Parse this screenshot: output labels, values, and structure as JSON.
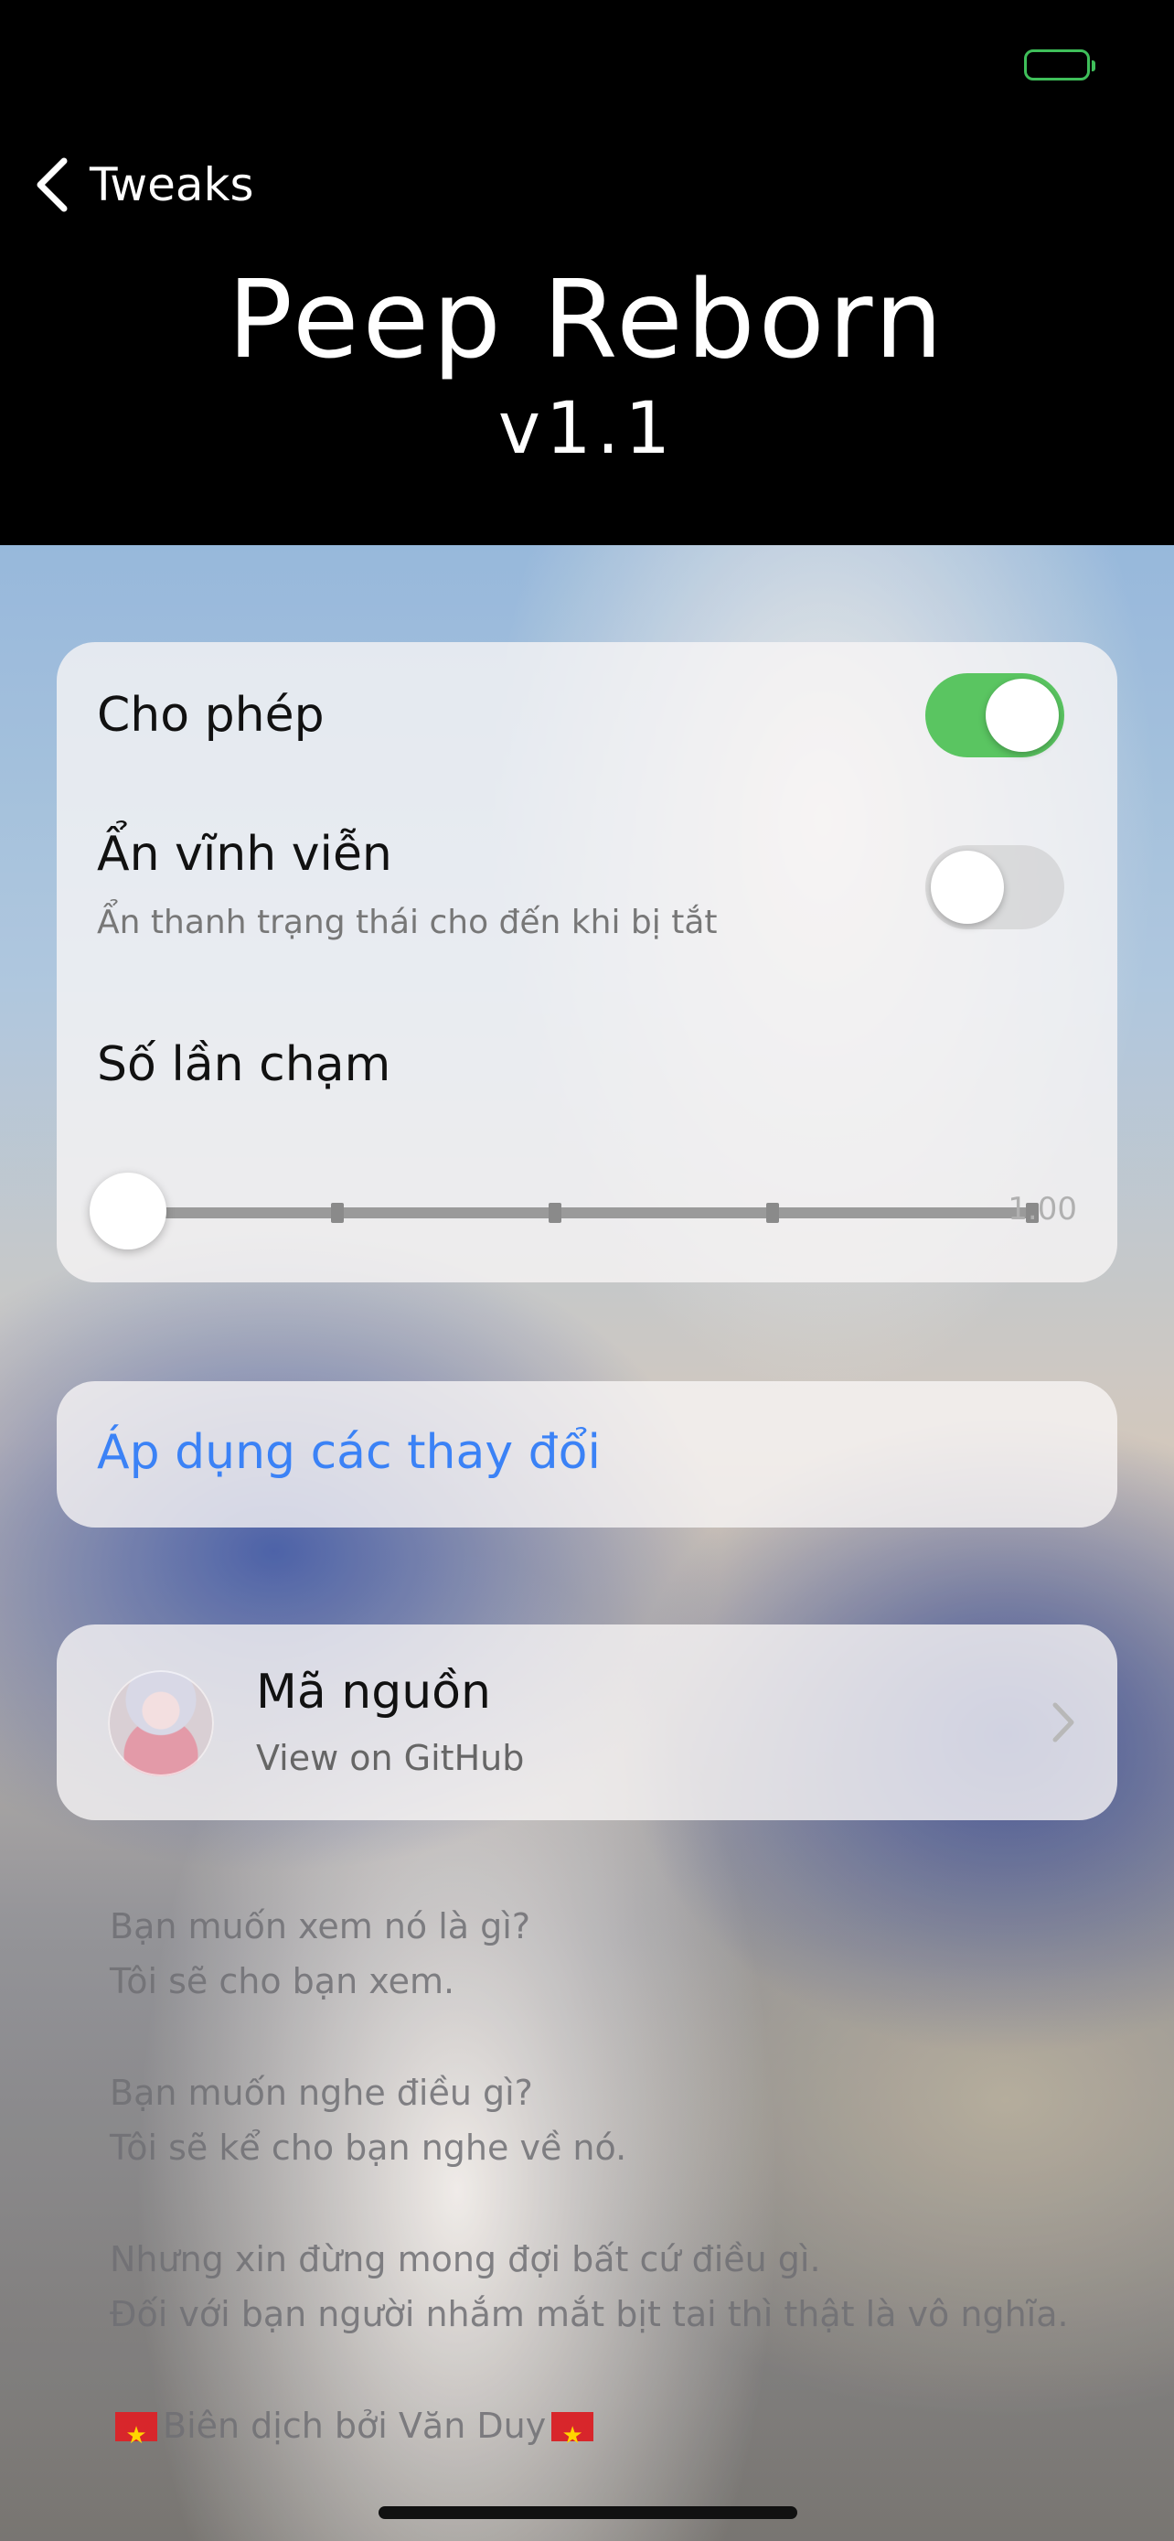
{
  "header": {
    "back_label": "Tweaks",
    "title": "Peep Reborn",
    "version": "v1.1"
  },
  "settings": {
    "enable": {
      "label": "Cho phép",
      "on": true
    },
    "hide_forever": {
      "label": "Ẩn vĩnh viễn",
      "subtitle": "Ẩn thanh trạng thái cho đến khi bị tắt",
      "on": false
    },
    "tap_count": {
      "label": "Số lần chạm",
      "value": "1.00"
    }
  },
  "apply": {
    "label": "Áp dụng các thay đổi"
  },
  "source": {
    "title": "Mã nguồn",
    "subtitle": "View on GitHub"
  },
  "paragraphs": {
    "p1_l1": "Bạn muốn xem nó là gì?",
    "p1_l2": "Tôi sẽ cho bạn xem.",
    "p2_l1": "Bạn muốn nghe điều gì?",
    "p2_l2": "Tôi sẽ kể cho bạn nghe về nó.",
    "p3_l1": "Nhưng xin đừng mong đợi bất cứ điều gì.",
    "p3_l2": "Đối với bạn người nhắm mắt bịt tai thì thật là vô nghĩa.",
    "credit": "Biên dịch bởi Văn Duy"
  },
  "colors": {
    "accent": "#3b82f6",
    "toggle_on": "#5ac561",
    "battery": "#3fbf5a"
  }
}
